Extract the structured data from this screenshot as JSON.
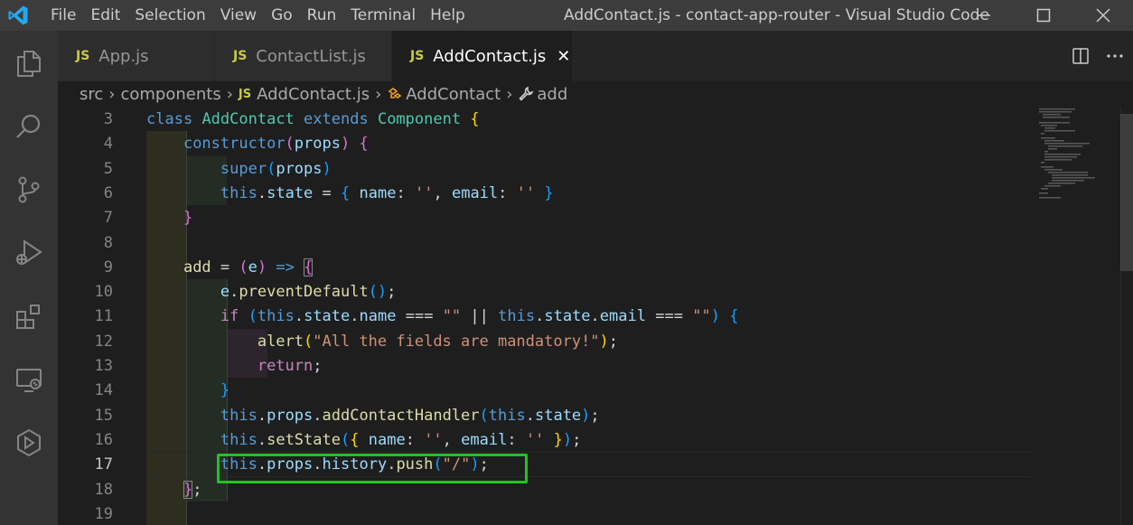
{
  "menu": [
    "File",
    "Edit",
    "Selection",
    "View",
    "Go",
    "Run",
    "Terminal",
    "Help"
  ],
  "window_title": "AddContact.js - contact-app-router - Visual Studio Code",
  "tabs": [
    {
      "icon_text": "JS",
      "label": "App.js",
      "active": false
    },
    {
      "icon_text": "JS",
      "label": "ContactList.js",
      "active": false
    },
    {
      "icon_text": "JS",
      "label": "AddContact.js",
      "active": true,
      "close": "✕"
    }
  ],
  "breadcrumb": {
    "parts": [
      "src",
      "components",
      "AddContact.js",
      "AddContact",
      "add"
    ],
    "js_icon_text": "JS"
  },
  "line_numbers": [
    "3",
    "4",
    "5",
    "6",
    "7",
    "8",
    "9",
    "10",
    "11",
    "12",
    "13",
    "14",
    "15",
    "16",
    "17",
    "18",
    "19"
  ],
  "current_line": "17",
  "colors": {
    "accent_highlight": "#22c322",
    "titlebar": "#3c3c3c",
    "activitybar": "#333333",
    "editor_bg": "#1e1e1e",
    "js_icon": "#cbcb41"
  },
  "icons": {
    "activity": [
      "explorer-icon",
      "search-icon",
      "source-control-icon",
      "run-debug-icon",
      "extensions-icon",
      "remote-explorer-icon",
      "docker-icon"
    ],
    "window": [
      "minimize-icon",
      "maximize-icon",
      "close-icon"
    ],
    "tab_actions": [
      "split-editor-icon",
      "more-actions-icon"
    ]
  },
  "code": {
    "l3": [
      "class",
      "AddContact",
      "extends",
      "Component",
      "{"
    ],
    "l4": [
      "constructor",
      "(",
      "props",
      ")",
      "{"
    ],
    "l5": [
      "super",
      "(",
      "props",
      ")"
    ],
    "l6": [
      "this",
      ".",
      "state",
      "=",
      "{",
      "name",
      ":",
      "''",
      ",",
      "email",
      ":",
      "''",
      "}"
    ],
    "l7": [
      "}"
    ],
    "l9": [
      "add",
      "=",
      "(",
      "e",
      ")",
      "=>",
      "{"
    ],
    "l10": [
      "e",
      ".",
      "preventDefault",
      "()",
      ";"
    ],
    "l11": [
      "if",
      "(",
      "this",
      ".",
      "state",
      ".",
      "name",
      "===",
      "\"\"",
      "||",
      "this",
      ".",
      "state",
      ".",
      "email",
      "===",
      "\"\"",
      ")",
      "{"
    ],
    "l12": [
      "alert",
      "(",
      "\"All the fields are mandatory!\"",
      ")",
      ";"
    ],
    "l13": [
      "return",
      ";"
    ],
    "l14": [
      "}"
    ],
    "l15": [
      "this",
      ".",
      "props",
      ".",
      "addContactHandler",
      "(",
      "this",
      ".",
      "state",
      ")",
      ";"
    ],
    "l16": [
      "this",
      ".",
      "setState",
      "(",
      "{",
      "name",
      ":",
      "''",
      ",",
      "email",
      ":",
      "''",
      "}",
      ")",
      ";"
    ],
    "l17": [
      "this",
      ".",
      "props",
      ".",
      "history",
      ".",
      "push",
      "(",
      "\"/\"",
      ")",
      ";"
    ],
    "l18": [
      "}",
      ";"
    ]
  }
}
